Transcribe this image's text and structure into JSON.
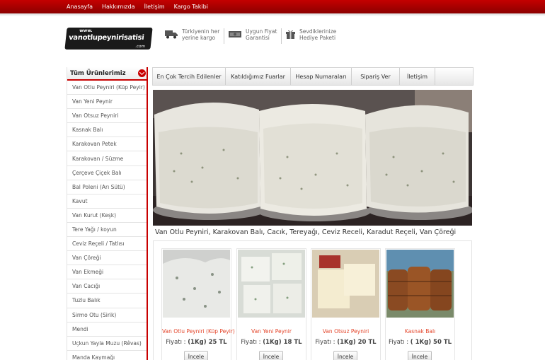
{
  "topnav": {
    "links": [
      "Anasayfa",
      "Hakkımızda",
      "İletişim",
      "Kargo Takibi"
    ]
  },
  "logo": {
    "www": "www.",
    "name": "vanotlupeynirisatisi",
    "tld": ".com"
  },
  "features": [
    {
      "icon": "truck-icon",
      "line1": "Türkiyenin her",
      "line2": "yerine kargo"
    },
    {
      "icon": "money-icon",
      "line1": "Uygun Fiyat",
      "line2": "Garantisi"
    },
    {
      "icon": "gift-icon",
      "line1": "Sevdiklerinize",
      "line2": "Hediye Paketi"
    }
  ],
  "sidebar": {
    "title": "Tüm Ürünlerimiz",
    "items": [
      "Van Otlu Peyniri (Küp Peyir)",
      "Van Yeni Peynir",
      "Van Otsuz Peyniri",
      "Kasnak Balı",
      "Karakovan Petek",
      "Karakovan / Süzme",
      "Çerçeve Çiçek Balı",
      "Bal Poleni (Arı Sütü)",
      "Kavut",
      "Van Kurut (Keşk)",
      "Tere Yağı / koyun",
      "Ceviz Reçeli / Tatlısı",
      "Van Çöreği",
      "Van Ekmeği",
      "Van Cacığı",
      "Tuzlu Balık",
      "Sirmo Otu (Sirik)",
      "Mendi",
      "Uçkun Yayla Muzu (Rêvas)",
      "Manda Kaymağı"
    ]
  },
  "nav": {
    "tabs": [
      "En Çok Tercih Edilenler",
      "Katıldığımız Fuarlar",
      "Hesap Numaraları",
      "Sipariş Ver",
      "İletişim"
    ]
  },
  "banner": {
    "caption": "Van Otlu Peyniri, Karakovan Balı, Cacık, Tereyağı, Ceviz Receli, Karadut Reçeli, Van Çöreği"
  },
  "products": [
    {
      "name": "Van Otlu Peyniri (Küp Peyir)",
      "price_label": "Fiyatı :",
      "price": "(1Kg) 25 TL",
      "button": "İncele"
    },
    {
      "name": "Van Yeni Peynir",
      "price_label": "Fiyatı :",
      "price": "(1Kg) 18 TL",
      "button": "İncele"
    },
    {
      "name": "Van Otsuz Peyniri",
      "price_label": "Fiyatı :",
      "price": "(1Kg) 20 TL",
      "button": "İncele"
    },
    {
      "name": "Kasnak Balı",
      "price_label": "Fiyatı :",
      "price": "( 1Kg) 50 TL",
      "button": "İncele"
    }
  ],
  "colors": {
    "brand_red": "#c80000",
    "product_name": "#e4452a"
  }
}
